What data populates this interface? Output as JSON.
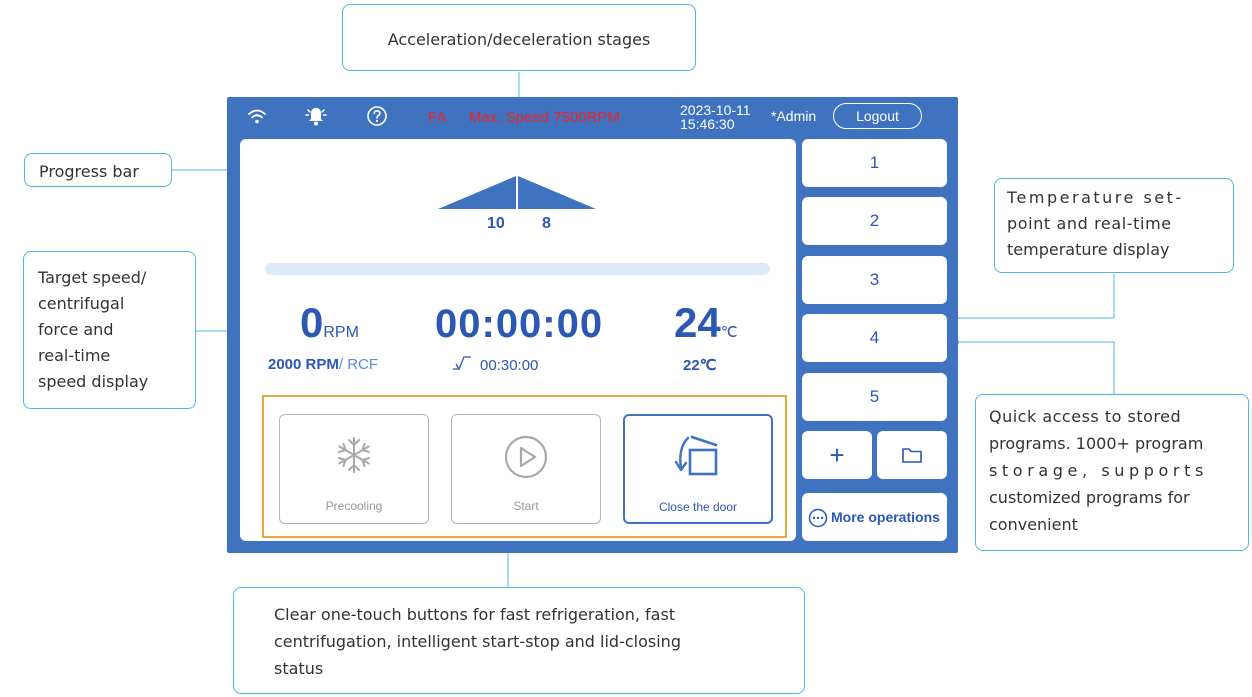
{
  "callouts": {
    "acceleration": "Acceleration/deceleration stages",
    "progress": "Progress bar",
    "speed_lines": [
      "Target speed/",
      "centrifugal",
      "force and",
      "real-time",
      "speed display"
    ],
    "temp_lines": [
      "Temperature set-",
      "point and real-time",
      "temperature display"
    ],
    "quick_lines": [
      "Quick access to stored",
      "programs. 1000+ program",
      "storage, supports",
      "customized programs for",
      "convenient"
    ],
    "buttons_lines": [
      "Clear one-touch buttons for fast refrigeration, fast",
      "centrifugation, intelligent start-stop and lid-closing",
      "status"
    ]
  },
  "status_bar": {
    "icons": [
      "wifi-icon",
      "bell-icon",
      "help-icon"
    ],
    "warning_code": "FA",
    "warning_text": "Max. Speed 7500RPM",
    "date": "2023-10-11",
    "time": "15:46:30",
    "user": "*Admin",
    "logout_label": "Logout"
  },
  "main": {
    "accel_stage": "10",
    "decel_stage": "8",
    "progress_percent": 0,
    "speed_value": "0",
    "speed_unit": "RPM",
    "timer": "00:00:00",
    "temp_value": "24",
    "temp_unit": "℃",
    "target_speed": "2000 RPM",
    "target_rcf": "/ RCF",
    "set_time": "00:30:00",
    "set_temp": "22℃"
  },
  "actions": {
    "precool_label": "Precooling",
    "start_label": "Start",
    "door_label": "Close the door"
  },
  "programs": [
    "1",
    "2",
    "3",
    "4",
    "5"
  ],
  "program_actions": {
    "add_label": "+",
    "more_label": "More operations"
  },
  "colors": {
    "device_frame": "#3f73c0",
    "accent_text": "#2c57b3",
    "warning": "#e8262a",
    "callout_border": "#4fb6de",
    "button_frame": "#e8a83a"
  }
}
